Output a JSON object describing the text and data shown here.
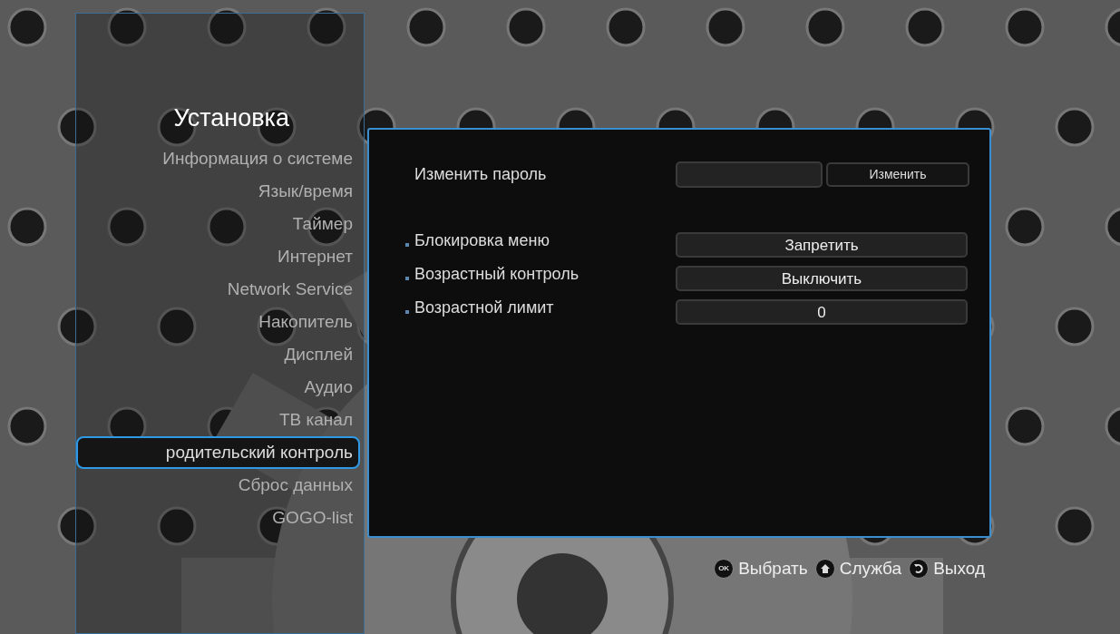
{
  "sidebar": {
    "title": "Установка",
    "items": [
      {
        "label": "Информация о системе",
        "selected": false
      },
      {
        "label": "Язык/время",
        "selected": false
      },
      {
        "label": "Таймер",
        "selected": false
      },
      {
        "label": "Интернет",
        "selected": false
      },
      {
        "label": "Network Service",
        "selected": false
      },
      {
        "label": "Накопитель",
        "selected": false
      },
      {
        "label": "Дисплей",
        "selected": false
      },
      {
        "label": "Аудио",
        "selected": false
      },
      {
        "label": "ТВ канал",
        "selected": false
      },
      {
        "label": "родительский контроль",
        "selected": true
      },
      {
        "label": "Сброс данных",
        "selected": false
      },
      {
        "label": "GOGO-list",
        "selected": false
      }
    ]
  },
  "settings": [
    {
      "kind": "password",
      "label": "Изменить пароль",
      "button": "Изменить"
    },
    {
      "kind": "option",
      "label": "Блокировка меню",
      "value": "Запретить"
    },
    {
      "kind": "option",
      "label": "Возрастный контроль",
      "value": "Выключить"
    },
    {
      "kind": "option",
      "label": "Возрастной лимит",
      "value": "0"
    }
  ],
  "hints": [
    {
      "kind": "ok",
      "icon_text": "OK",
      "label": "Выбрать"
    },
    {
      "kind": "home",
      "label": "Служба"
    },
    {
      "kind": "back",
      "label": "Выход"
    }
  ]
}
